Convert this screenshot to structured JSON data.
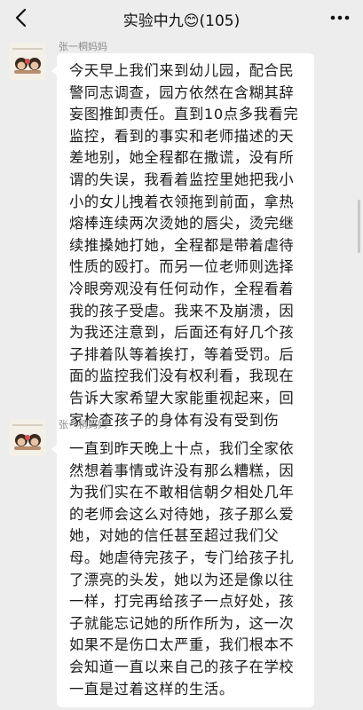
{
  "nav": {
    "back_icon": "chevron-left-icon",
    "title": "实验中九😊(105)",
    "more_icon": "ellipsis-icon"
  },
  "messages": [
    {
      "sender": "张一桐妈妈",
      "text": "今天早上我们来到幼儿园，配合民警同志调查，园方依然在含糊其辞妄图推卸责任。直到10点多我看完监控，看到的事实和老师描述的天差地别，她全程都在撒谎，没有所谓的失误，我看着监控里她把我小小的女儿拽着衣领拖到前面，拿热熔棒连续两次烫她的唇尖，烫完继续推搡她打她，全程都是带着虐待性质的殴打。而另一位老师则选择冷眼旁观没有任何动作，全程看着我的孩子受虐。我来不及崩溃，因为我还注意到，后面还有好几个孩子排着队等着挨打，等着受罚。后面的监控我们没有权利看，我现在告诉大家希望大家能重视起来，回家检查孩子的身体有没有受到伤害。"
    },
    {
      "sender": "张一桐妈妈",
      "text": "一直到昨天晚上十点，我们全家依然想着事情或许没有那么糟糕，因为我们实在不敢相信朝夕相处几年的老师会这么对待她，孩子那么爱她，对她的信任甚至超过我们父母。她虐待完孩子，专门给孩子扎了漂亮的头发，她以为还是像以往一样，打完再给孩子一点好处，孩子就能忘记她的所作所为，这一次如果不是伤口太严重，我们根本不会知道一直以来自己的孩子在学校一直是过着这样的生活。"
    }
  ]
}
